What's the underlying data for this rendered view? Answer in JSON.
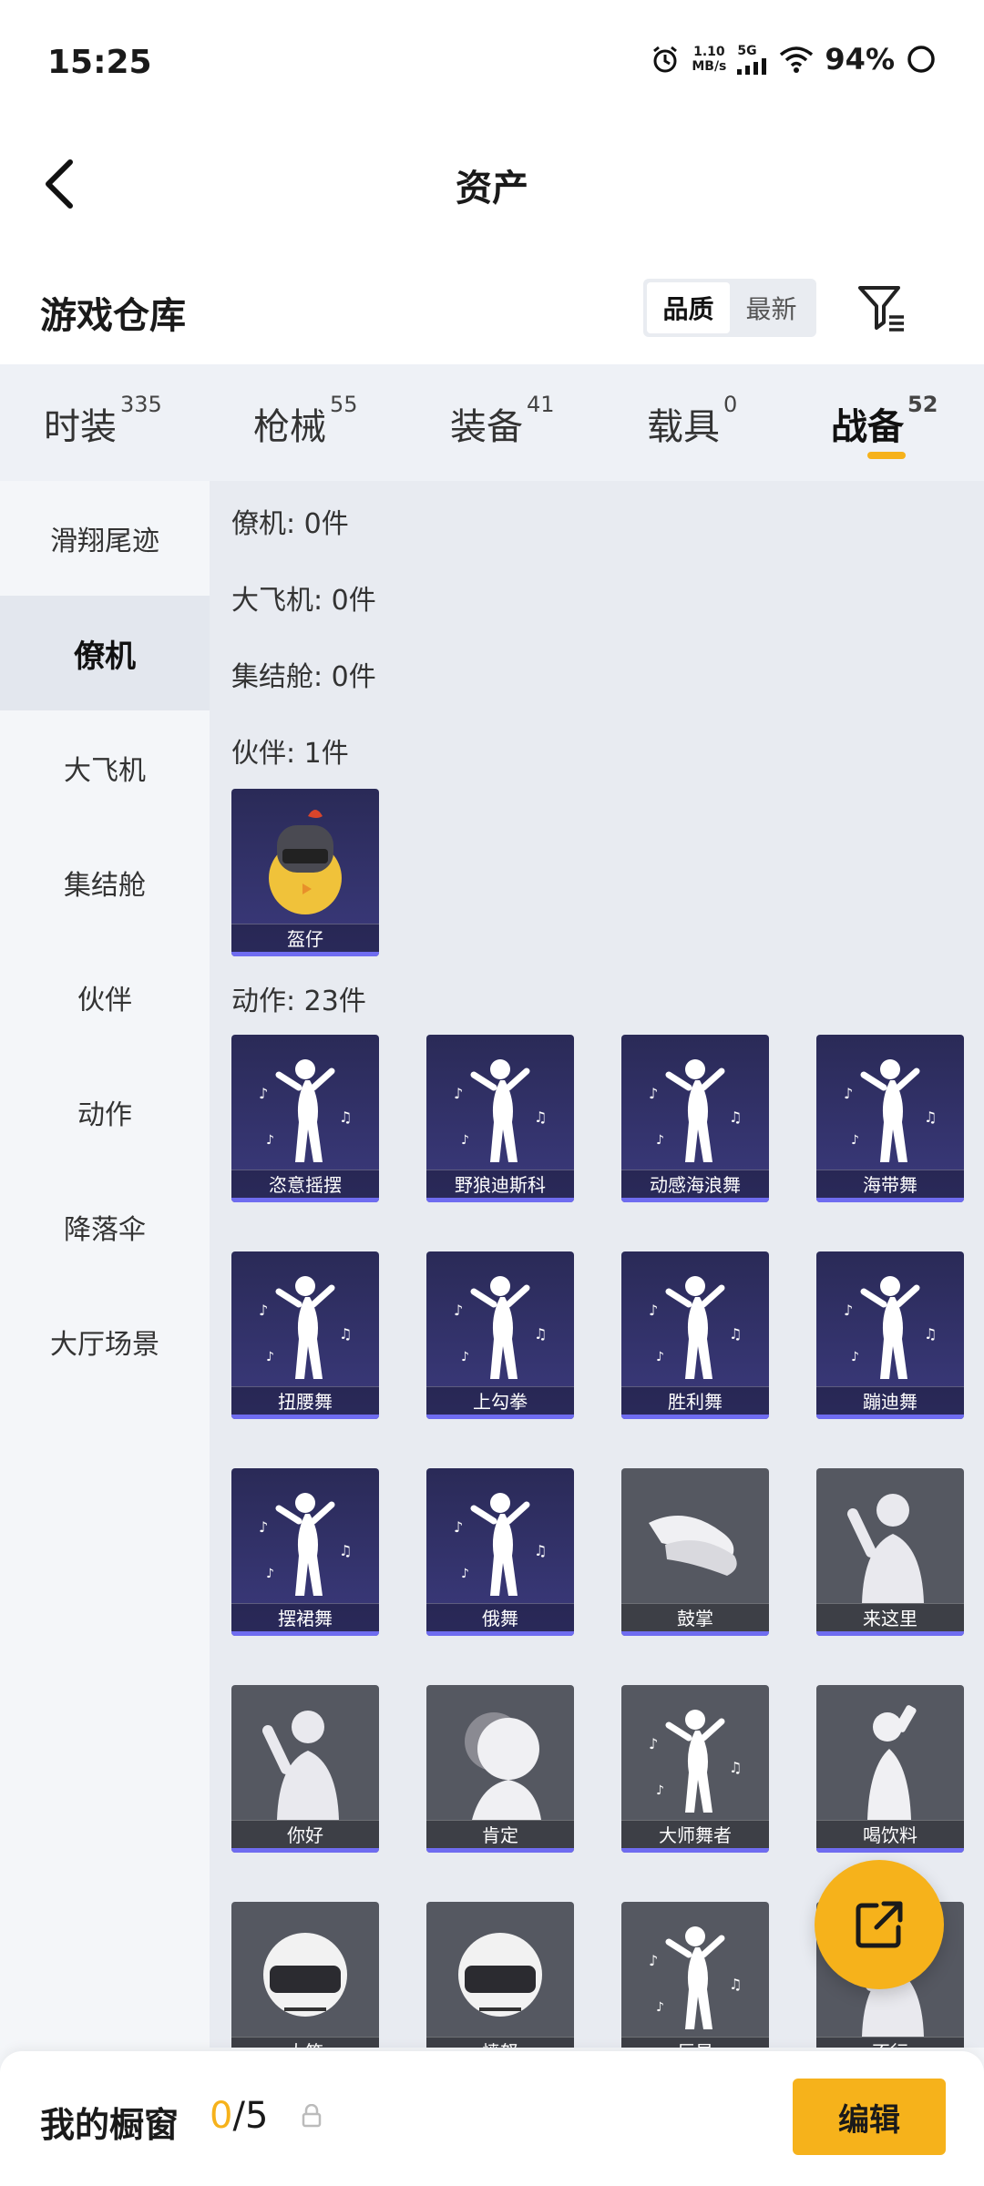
{
  "status_bar": {
    "time": "15:25",
    "net_speed_value": "1.10",
    "net_speed_unit": "MB/s",
    "network_type": "5G",
    "battery": "94%"
  },
  "header": {
    "title": "资产"
  },
  "section": {
    "title": "游戏仓库",
    "sort_options": [
      "品质",
      "最新"
    ],
    "active_sort": "品质"
  },
  "category_tabs": [
    {
      "label": "时装",
      "count": "335"
    },
    {
      "label": "枪械",
      "count": "55"
    },
    {
      "label": "装备",
      "count": "41"
    },
    {
      "label": "载具",
      "count": "0"
    },
    {
      "label": "战备",
      "count": "52",
      "active": true
    }
  ],
  "sidebar": {
    "items": [
      "滑翔尾迹",
      "僚机",
      "大飞机",
      "集结舱",
      "伙伴",
      "动作",
      "降落伞",
      "大厅场景"
    ],
    "active_index": 1
  },
  "content": {
    "groups": [
      {
        "label": "僚机: 0件"
      },
      {
        "label": "大飞机: 0件"
      },
      {
        "label": "集结舱: 0件"
      },
      {
        "label": "伙伴: 1件",
        "items": [
          "盔仔"
        ]
      },
      {
        "label": "动作: 23件",
        "items": [
          "恣意摇摆",
          "野狼迪斯科",
          "动感海浪舞",
          "海带舞",
          "扭腰舞",
          "上勾拳",
          "胜利舞",
          "蹦迪舞",
          "摆裙舞",
          "俄舞",
          "鼓掌",
          "来这里",
          "你好",
          "肯定",
          "大师舞者",
          "喝饮料",
          "大笑",
          "愤怒",
          "巨星",
          "不行"
        ]
      }
    ]
  },
  "bottom_bar": {
    "label": "我的橱窗",
    "count_current": "0",
    "count_sep": "/",
    "count_max": "5",
    "edit_label": "编辑"
  },
  "colors": {
    "accent": "#f6b21b",
    "purple_card": "#3b3a7d",
    "gray_card": "#555861",
    "bar": "#6f6cf0"
  },
  "icons": [
    "back-arrow-icon",
    "filter-icon",
    "alarm-icon",
    "wifi-icon",
    "signal-icon",
    "battery-icon",
    "lock-icon",
    "share-icon"
  ]
}
